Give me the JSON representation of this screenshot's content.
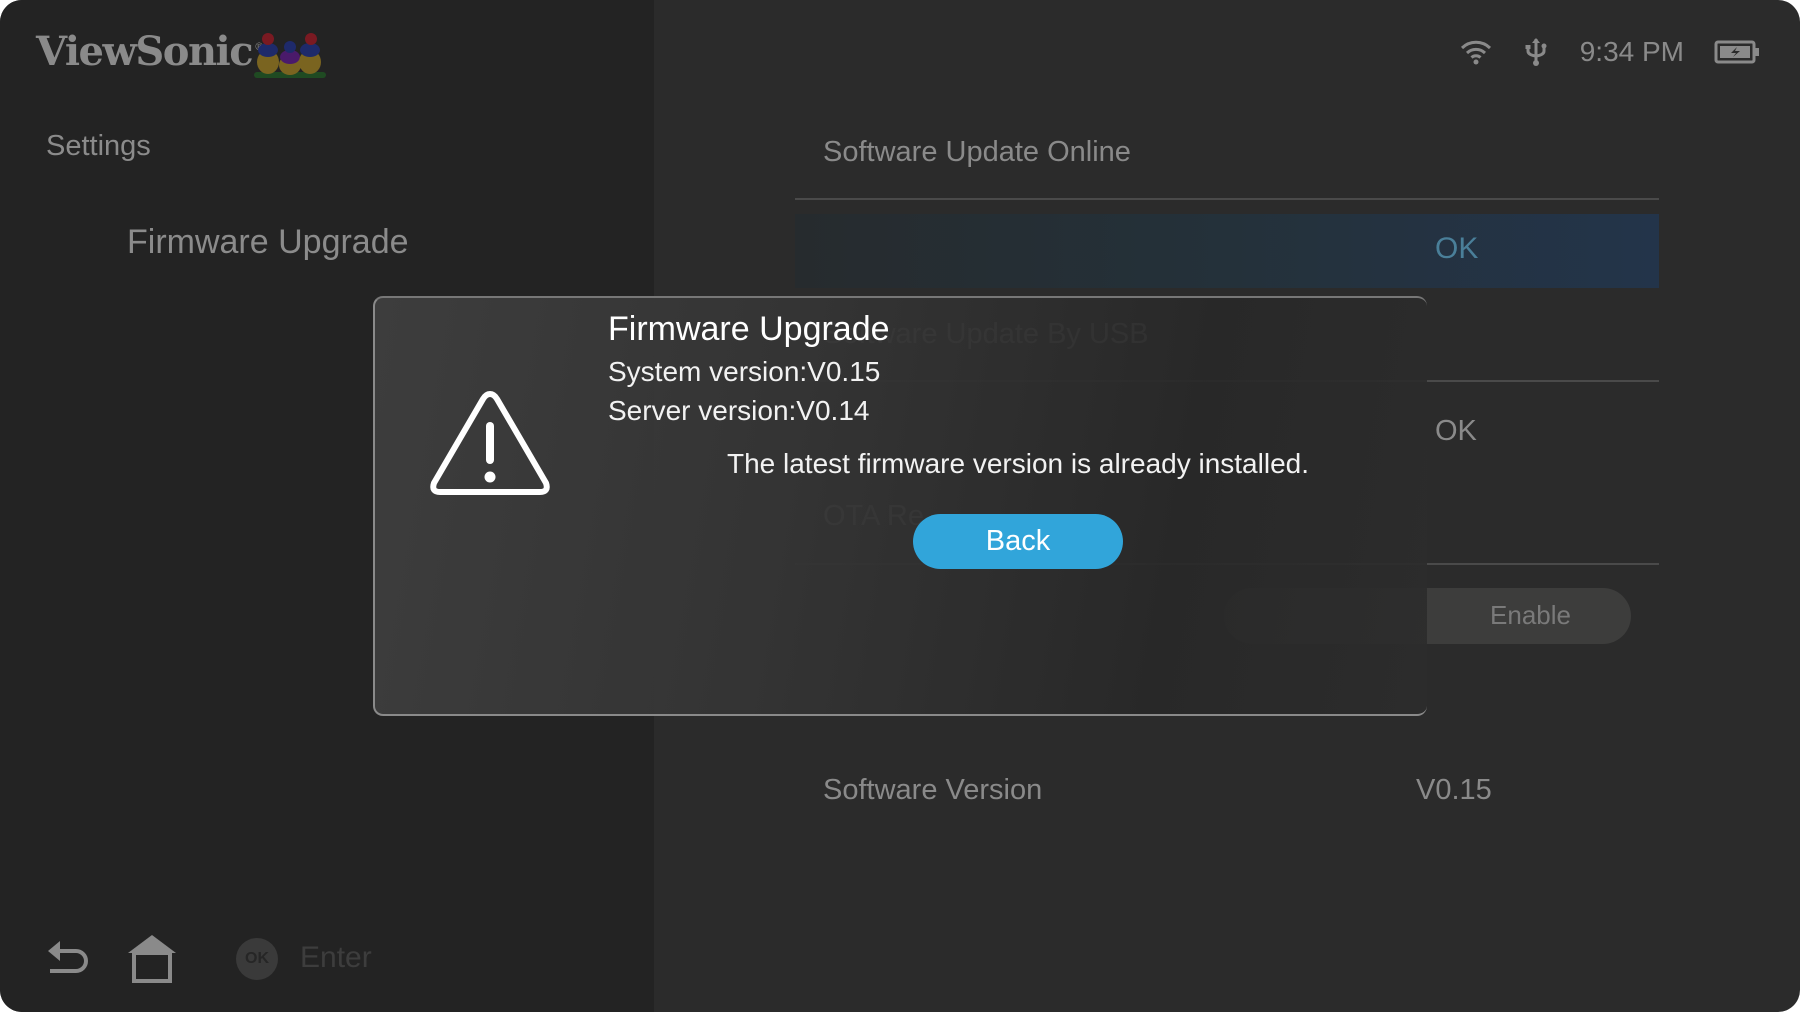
{
  "brand": {
    "name": "ViewSonic",
    "registered": "®",
    "mascot": "three-birds-logo"
  },
  "status_bar": {
    "icons": [
      "wifi-icon",
      "usb-icon",
      "battery-charging-icon"
    ],
    "time": "9:34 PM"
  },
  "sidebar": {
    "heading": "Settings",
    "items": [
      {
        "label": "Firmware Upgrade",
        "selected": true
      }
    ]
  },
  "bottom_bar": {
    "back_icon": "back-arrow-icon",
    "home_icon": "home-icon",
    "ok_badge": "OK",
    "ok_hint": "Enter"
  },
  "main": {
    "rows": [
      {
        "label": "Software Update Online",
        "action": "OK",
        "focused": true
      },
      {
        "label": "Software Update By USB",
        "action": "OK"
      },
      {
        "label": "OTA Re",
        "toggle_label": "Enable"
      },
      {
        "label": "Software Version",
        "value": "V0.15"
      }
    ],
    "highlight_color": "#23344a"
  },
  "dialog": {
    "icon": "warning-icon",
    "title": "Firmware Upgrade",
    "system_version": "System version:V0.15",
    "server_version": "Server version:V0.14",
    "message": "The latest firmware version is already installed.",
    "back_label": "Back",
    "accent": "#31a5da"
  }
}
